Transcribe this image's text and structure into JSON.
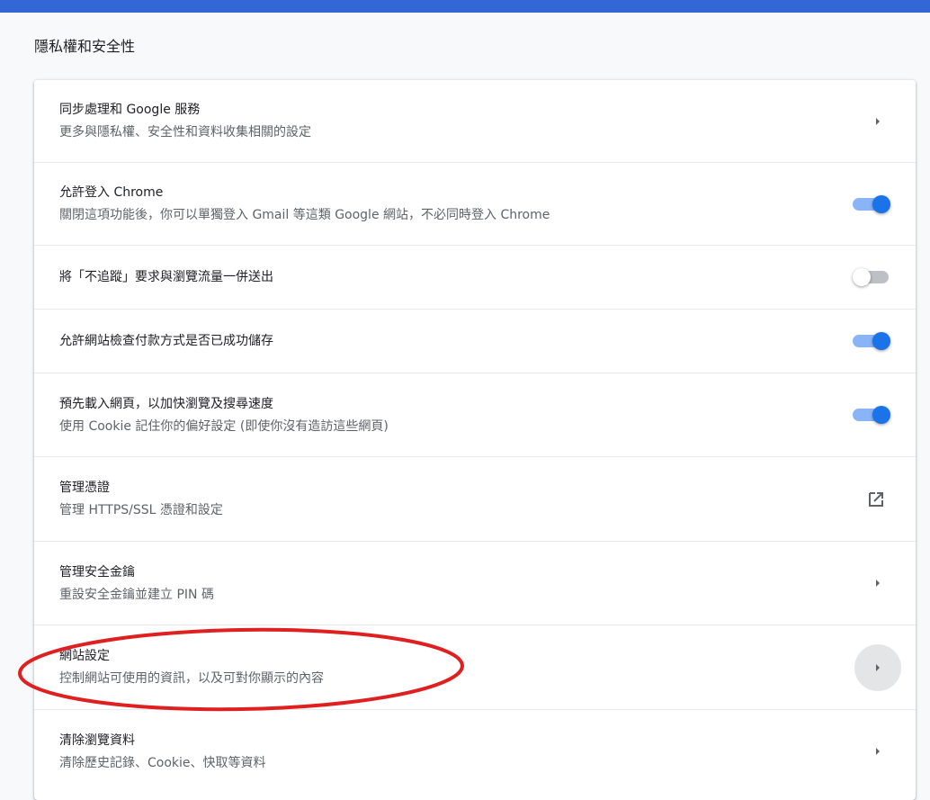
{
  "section_title": "隱私權和安全性",
  "accent_color": "#1a73e8",
  "annotation_color": "#e02020",
  "rows": [
    {
      "title": "同步處理和 Google 服務",
      "subtitle": "更多與隱私權、安全性和資料收集相關的設定",
      "control": "chevron-right-icon"
    },
    {
      "title": "允許登入 Chrome",
      "subtitle": "關閉這項功能後，你可以單獨登入 Gmail 等這類 Google 網站，不必同時登入 Chrome",
      "control": "toggle",
      "enabled": true
    },
    {
      "title": "將「不追蹤」要求與瀏覽流量一併送出",
      "control": "toggle",
      "enabled": false
    },
    {
      "title": "允許網站檢查付款方式是否已成功儲存",
      "control": "toggle",
      "enabled": true
    },
    {
      "title": "預先載入網頁，以加快瀏覽及搜尋速度",
      "subtitle": "使用 Cookie 記住你的偏好設定 (即使你沒有造訪這些網頁)",
      "control": "toggle",
      "enabled": true
    },
    {
      "title": "管理憑證",
      "subtitle": "管理 HTTPS/SSL 憑證和設定",
      "control": "open-in-new-icon"
    },
    {
      "title": "管理安全金鑰",
      "subtitle": "重設安全金鑰並建立 PIN 碼",
      "control": "chevron-right-icon"
    },
    {
      "title": "網站設定",
      "subtitle": "控制網站可使用的資訊，以及可對你顯示的內容",
      "control": "chevron-right-icon",
      "highlighted": true
    },
    {
      "title": "清除瀏覽資料",
      "subtitle": "清除歷史記錄、Cookie、快取等資料",
      "control": "chevron-right-icon"
    }
  ]
}
